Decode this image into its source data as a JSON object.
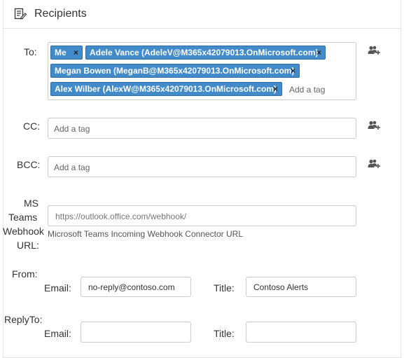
{
  "header": {
    "title": "Recipients",
    "icon": "edit-form-icon"
  },
  "to": {
    "label": "To:",
    "tags": [
      {
        "text": "Me",
        "remove": "×"
      },
      {
        "text": "Adele Vance (AdeleV@M365x42079013.OnMicrosoft.com)",
        "remove": "×"
      },
      {
        "text": "Megan Bowen (MeganB@M365x42079013.OnMicrosoft.com)",
        "remove": "×"
      },
      {
        "text": "Alex Wilber (AlexW@M365x42079013.OnMicrosoft.com)",
        "remove": "×"
      }
    ],
    "input_placeholder": "Add a tag",
    "picker_icon": "add-people-icon"
  },
  "cc": {
    "label": "CC:",
    "input_placeholder": "Add a tag",
    "picker_icon": "add-people-icon"
  },
  "bcc": {
    "label": "BCC:",
    "input_placeholder": "Add a tag",
    "picker_icon": "add-people-icon"
  },
  "webhook": {
    "label_lines": [
      "MS",
      "Teams",
      "Webhook",
      "URL:"
    ],
    "placeholder": "https://outlook.office.com/webhook/",
    "hint": "Microsoft Teams Incoming Webhook Connector URL"
  },
  "from": {
    "label": "From:",
    "email_label": "Email:",
    "email_value": "no-reply@contoso.com",
    "title_label": "Title:",
    "title_value": "Contoso Alerts"
  },
  "reply_to": {
    "label": "ReplyTo:",
    "email_label": "Email:",
    "email_value": "",
    "title_label": "Title:",
    "title_value": ""
  },
  "colors": {
    "tag_bg": "#428bca",
    "border": "#cccccc",
    "text": "#333333"
  }
}
